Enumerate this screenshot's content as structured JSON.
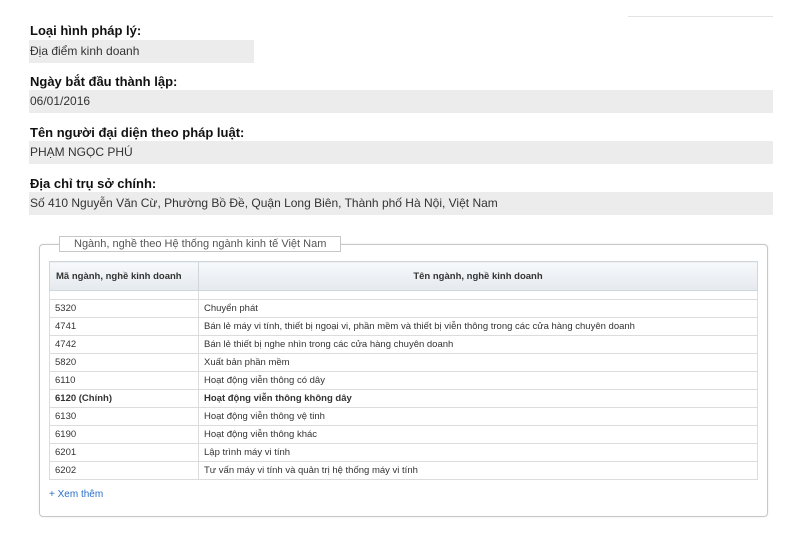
{
  "fields": [
    {
      "label": "Loại hình pháp lý:",
      "value": "Địa điểm kinh doanh"
    },
    {
      "label": "Ngày bắt đầu thành lập:",
      "value": "06/01/2016"
    },
    {
      "label": "Tên người đại diện theo pháp luật:",
      "value": "PHẠM NGỌC PHÚ"
    },
    {
      "label": "Địa chỉ trụ sở chính:",
      "value": "Số 410 Nguyễn Văn Cừ, Phường Bồ Đề, Quận Long Biên, Thành phố Hà Nội, Việt Nam"
    }
  ],
  "industry": {
    "legend": "Ngành, nghề theo Hệ thống ngành kinh tế Việt Nam",
    "columns": [
      "Mã ngành, nghề kinh doanh",
      "Tên ngành, nghề kinh doanh"
    ],
    "rows": [
      {
        "code": "5320",
        "name": "Chuyển phát"
      },
      {
        "code": "4741",
        "name": "Bán lẻ máy vi tính, thiết bị ngoại vi, phần mềm và thiết bị viễn thông trong các cửa hàng chuyên doanh"
      },
      {
        "code": "4742",
        "name": "Bán lẻ thiết bị nghe nhìn trong các cửa hàng chuyên doanh"
      },
      {
        "code": "5820",
        "name": "Xuất bản phần mềm"
      },
      {
        "code": "6110",
        "name": "Hoạt động viễn thông có dây"
      },
      {
        "code": "6120 (Chính)",
        "name": "Hoạt động viễn thông không dây"
      },
      {
        "code": "6130",
        "name": "Hoạt động viễn thông vệ tinh"
      },
      {
        "code": "6190",
        "name": "Hoạt động viễn thông khác"
      },
      {
        "code": "6201",
        "name": "Lập trình máy vi tính"
      },
      {
        "code": "6202",
        "name": "Tư vấn máy vi tính và quản trị hệ thống máy vi tính"
      }
    ],
    "more_link": "+ Xem thêm"
  }
}
